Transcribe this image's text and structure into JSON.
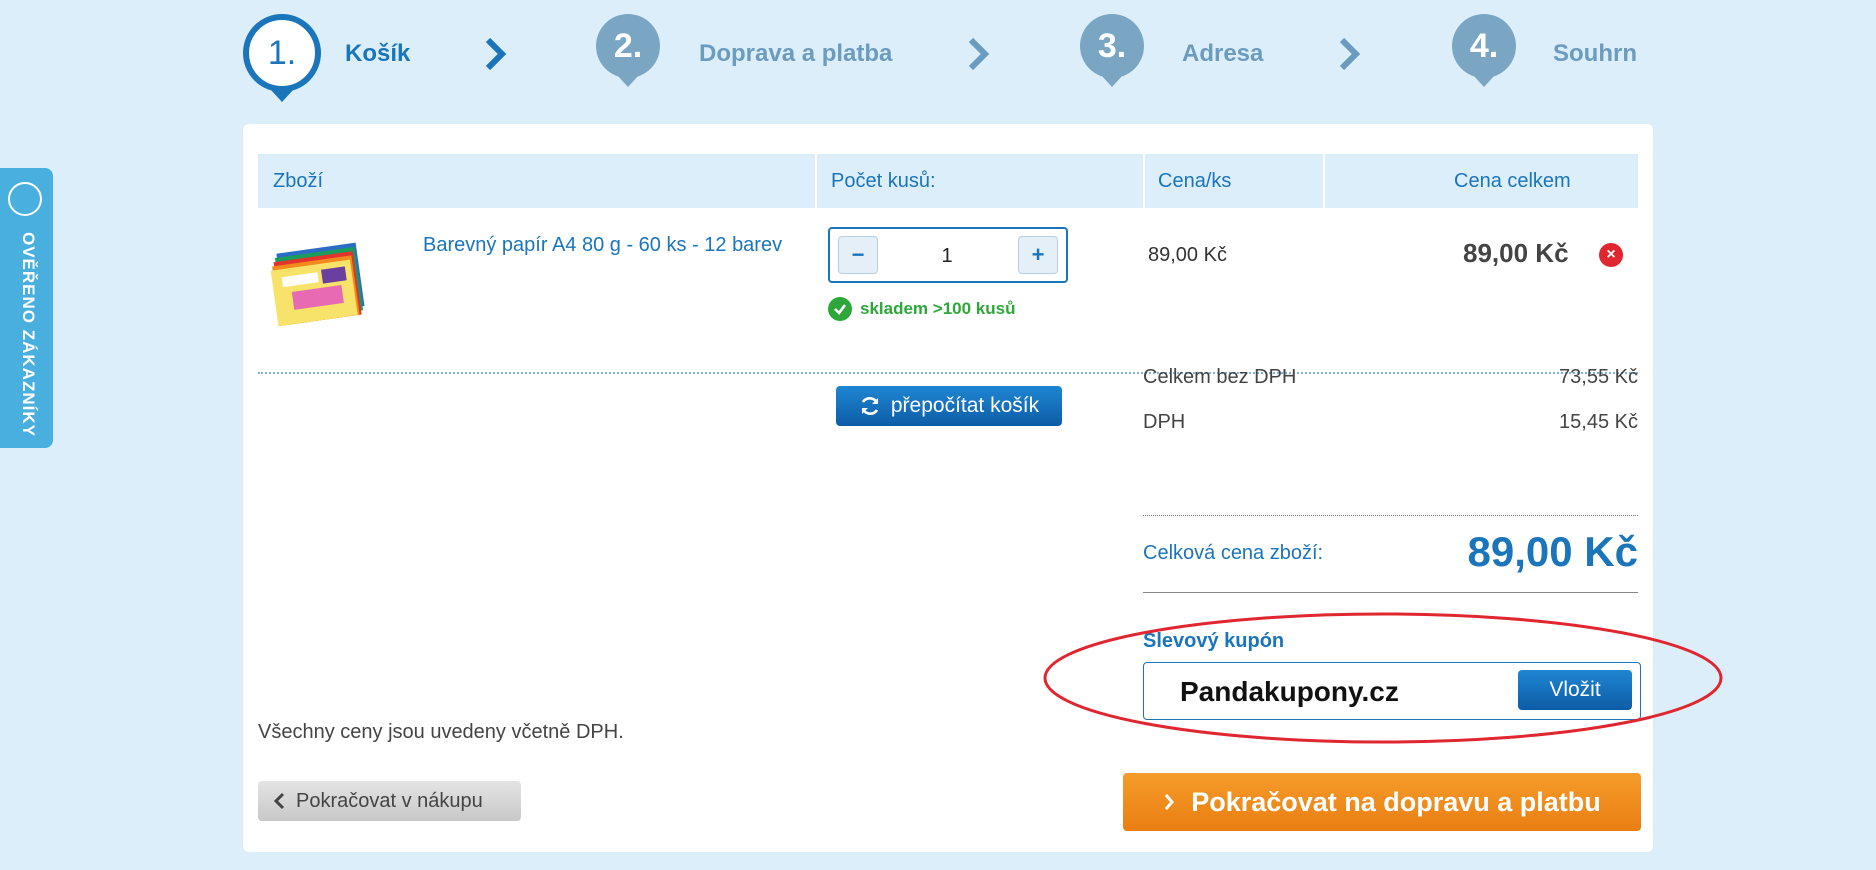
{
  "steps": [
    {
      "number": "1.",
      "label": "Košík",
      "active": true
    },
    {
      "number": "2.",
      "label": "Doprava a platba",
      "active": false
    },
    {
      "number": "3.",
      "label": "Adresa",
      "active": false
    },
    {
      "number": "4.",
      "label": "Souhrn",
      "active": false
    }
  ],
  "badge": {
    "text": "OVĚŘENO ZÁKAZNÍKY"
  },
  "table": {
    "headers": [
      "Zboží",
      "Počet kusů:",
      "Cena/ks",
      "Cena celkem"
    ]
  },
  "item": {
    "name": "Barevný papír A4 80 g - 60 ks - 12 barev",
    "quantity": "1",
    "qty_minus": "−",
    "qty_plus": "+",
    "stock": "skladem >100 kusů",
    "unit_price": "89,00 Kč",
    "total_price": "89,00 Kč",
    "remove": "×"
  },
  "recalc_label": "přepočítat košík",
  "summary": {
    "without_vat_label": "Celkem bez DPH",
    "without_vat_value": "73,55 Kč",
    "vat_label": "DPH",
    "vat_value": "15,45 Kč",
    "total_label": "Celková cena zboží:",
    "total_value": "89,00 Kč"
  },
  "coupon": {
    "label": "Slevový kupón",
    "value": "Pandakupony.cz",
    "button": "Vložit"
  },
  "vat_note": "Všechny ceny jsou uvedeny včetně DPH.",
  "back_button": "Pokračovat v nákupu",
  "next_button": "Pokračovat na dopravu a platbu",
  "colors": {
    "accent": "#1b75bb",
    "cta": "#f08a1c",
    "stock_ok": "#2ea73a",
    "highlight": "#e0262f"
  }
}
